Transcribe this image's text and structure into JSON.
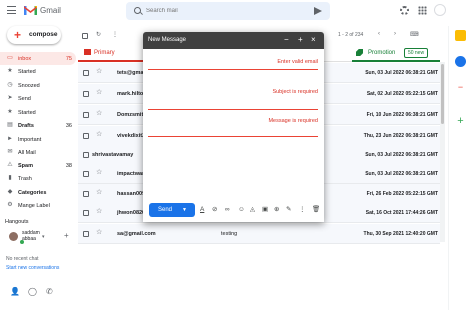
{
  "header": {
    "app_title": "Gmail",
    "search_placeholder": "Search mail"
  },
  "compose": {
    "label": "compose"
  },
  "sidebar": {
    "items": [
      {
        "label": "inbox",
        "count": "75",
        "icon": "inbox-icon"
      },
      {
        "label": "Started",
        "count": "",
        "icon": "star-icon"
      },
      {
        "label": "Snoozed",
        "count": "",
        "icon": "clock-icon"
      },
      {
        "label": "Send",
        "count": "",
        "icon": "send-icon"
      },
      {
        "label": "Started",
        "count": "",
        "icon": "star-icon"
      },
      {
        "label": "Drafts",
        "count": "36",
        "icon": "draft-icon"
      },
      {
        "label": "Important",
        "count": "",
        "icon": "important-icon"
      },
      {
        "label": "All Mail",
        "count": "",
        "icon": "mail-icon"
      },
      {
        "label": "Spam",
        "count": "38",
        "icon": "spam-icon"
      },
      {
        "label": "Trash",
        "count": "",
        "icon": "trash-icon"
      },
      {
        "label": "Categories",
        "count": "",
        "icon": "label-icon"
      },
      {
        "label": "Mange Label",
        "count": "",
        "icon": "gear-icon"
      }
    ]
  },
  "hangouts": {
    "title": "Hangouts",
    "user_name": "saddam abbaa",
    "no_chat": "No recent chat",
    "start_new": "Start new conversations"
  },
  "toolbar": {
    "pager": "1 - 2 of 234"
  },
  "tabs": {
    "primary": "Primary",
    "promotion": "Promotion",
    "promotion_badge": "50 new"
  },
  "emails": [
    {
      "sender": "tets@gmail.com",
      "subject": "",
      "date": "Sun, 03 Jul 2022 06:38:21 GMT"
    },
    {
      "sender": "mark.hilton@...",
      "subject": "",
      "date": "Sat, 02 Jul 2022 05:22:15 GMT"
    },
    {
      "sender": "Domzsmith69",
      "subject": "",
      "date": "Fri, 10 Jun 2022 06:38:21 GMT"
    },
    {
      "sender": "vivekdixit29",
      "subject": "",
      "date": "Thu, 23 Jun 2022 06:38:21 GMT"
    },
    {
      "sender": "shrivastavamay",
      "subject": "",
      "date": "Sun, 03 Jul 2022 06:38:21 GMT"
    },
    {
      "sender": "impactware@in",
      "subject": "",
      "date": "Sun, 03 Jul 2022 06:38:21 GMT"
    },
    {
      "sender": "hassan00942@",
      "subject": "",
      "date": "Fri, 26 Feb 2022 05:22:15 GMT"
    },
    {
      "sender": "jhwon0820@",
      "subject": "",
      "date": "Sat, 16 Oct 2021 17:44:26 GMT"
    },
    {
      "sender": "sa@gmail.com",
      "subject": "testing",
      "date": "Thu, 30 Sep 2021 12:40:20 GMT"
    }
  ],
  "compose_window": {
    "title": "New Message",
    "errors": {
      "email": "Enter valid email",
      "subject": "Subject is required",
      "message": "Message is required"
    },
    "send_label": "Send"
  },
  "colors": {
    "accent_red": "#d93025",
    "promo_green": "#188038",
    "send_blue": "#1a73e8",
    "header_dark": "#404040"
  }
}
